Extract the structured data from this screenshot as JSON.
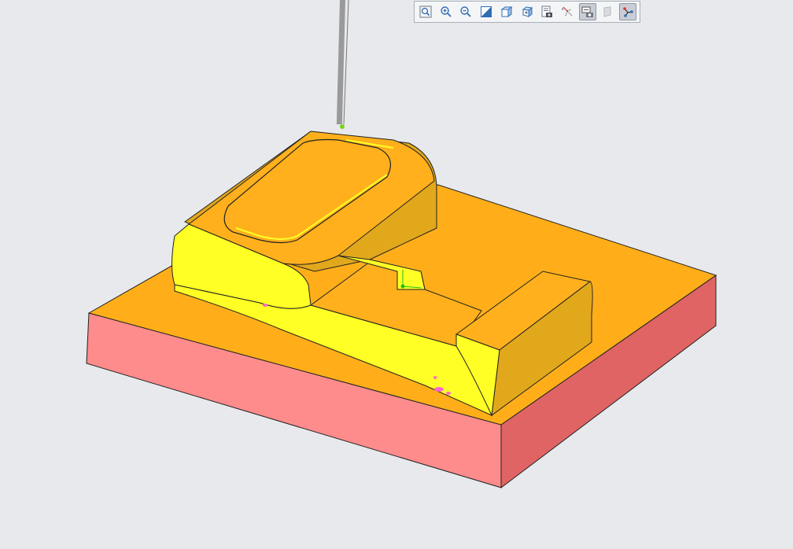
{
  "viewport": {
    "background_color": "#e8e9ec"
  },
  "model": {
    "stock_top_color": "#ffae1a",
    "stock_side_color": "#ff8c8c",
    "stock_side_dark_color": "#e06464",
    "part_top_color": "#ffb01c",
    "part_highlight_color": "#ffff26",
    "part_side_color": "#e2a81c",
    "tool_color": "#9a9a9a",
    "csys_color": "#19c019"
  },
  "toolbar": {
    "buttons": [
      {
        "icon": "zoom-fit-icon",
        "active": false
      },
      {
        "icon": "zoom-in-icon",
        "active": false
      },
      {
        "icon": "zoom-out-icon",
        "active": false
      },
      {
        "icon": "repaint-icon",
        "active": false
      },
      {
        "icon": "display-style-icon",
        "active": false
      },
      {
        "icon": "saved-orientations-icon",
        "active": false
      },
      {
        "icon": "view-manager-icon",
        "active": false
      },
      {
        "icon": "datum-display-filters-icon",
        "active": false
      },
      {
        "icon": "annotation-display-icon",
        "active": true
      },
      {
        "icon": "spin-center-icon",
        "active": false
      },
      {
        "icon": "toggle-display-icon",
        "active": true
      }
    ]
  }
}
